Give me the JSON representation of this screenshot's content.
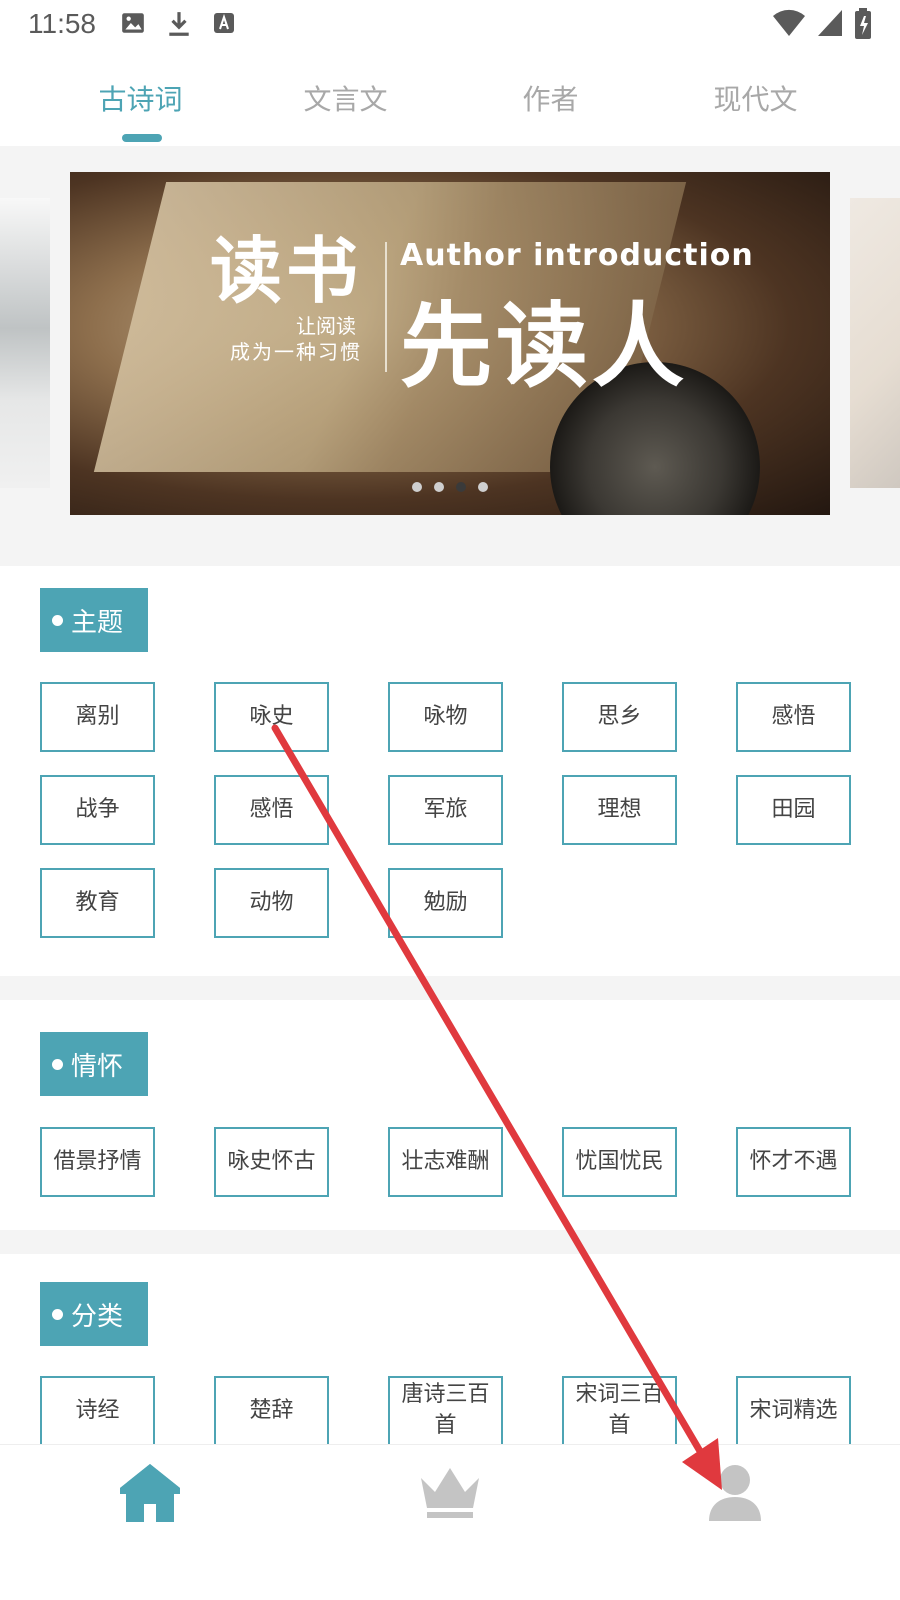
{
  "status_bar": {
    "time": "11:58",
    "icons_left": [
      "image-icon",
      "download-icon",
      "text-icon"
    ],
    "icons_right": [
      "wifi-icon",
      "signal-icon",
      "battery-icon"
    ]
  },
  "tabs": [
    {
      "label": "古诗词",
      "active": true
    },
    {
      "label": "文言文",
      "active": false
    },
    {
      "label": "作者",
      "active": false
    },
    {
      "label": "现代文",
      "active": false
    }
  ],
  "banner": {
    "big_left": "读书",
    "small_line1": "让阅读",
    "small_line2": "成为一种习惯",
    "english": "Author introduction",
    "big_right": "先读人",
    "dots": [
      false,
      false,
      true,
      false
    ]
  },
  "sections": {
    "theme": {
      "title": "主题",
      "chips": [
        "离别",
        "咏史",
        "咏物",
        "思乡",
        "感悟",
        "战争",
        "感悟",
        "军旅",
        "理想",
        "田园",
        "教育",
        "动物",
        "勉励"
      ]
    },
    "sentiment": {
      "title": "情怀",
      "chips": [
        "借景抒情",
        "咏史怀古",
        "壮志难酬",
        "忧国忧民",
        "怀才不遇"
      ]
    },
    "category": {
      "title": "分类",
      "chips": [
        "诗经",
        "楚辞",
        "唐诗三百首",
        "宋词三百首",
        "宋词精选"
      ]
    }
  },
  "bottom_nav": [
    {
      "icon": "home-icon",
      "active": true
    },
    {
      "icon": "crown-icon",
      "active": false
    },
    {
      "icon": "user-icon",
      "active": false
    }
  ],
  "colors": {
    "accent": "#4da4b4",
    "inactive": "#c4c4c4",
    "annotation_arrow": "#e0393e"
  }
}
